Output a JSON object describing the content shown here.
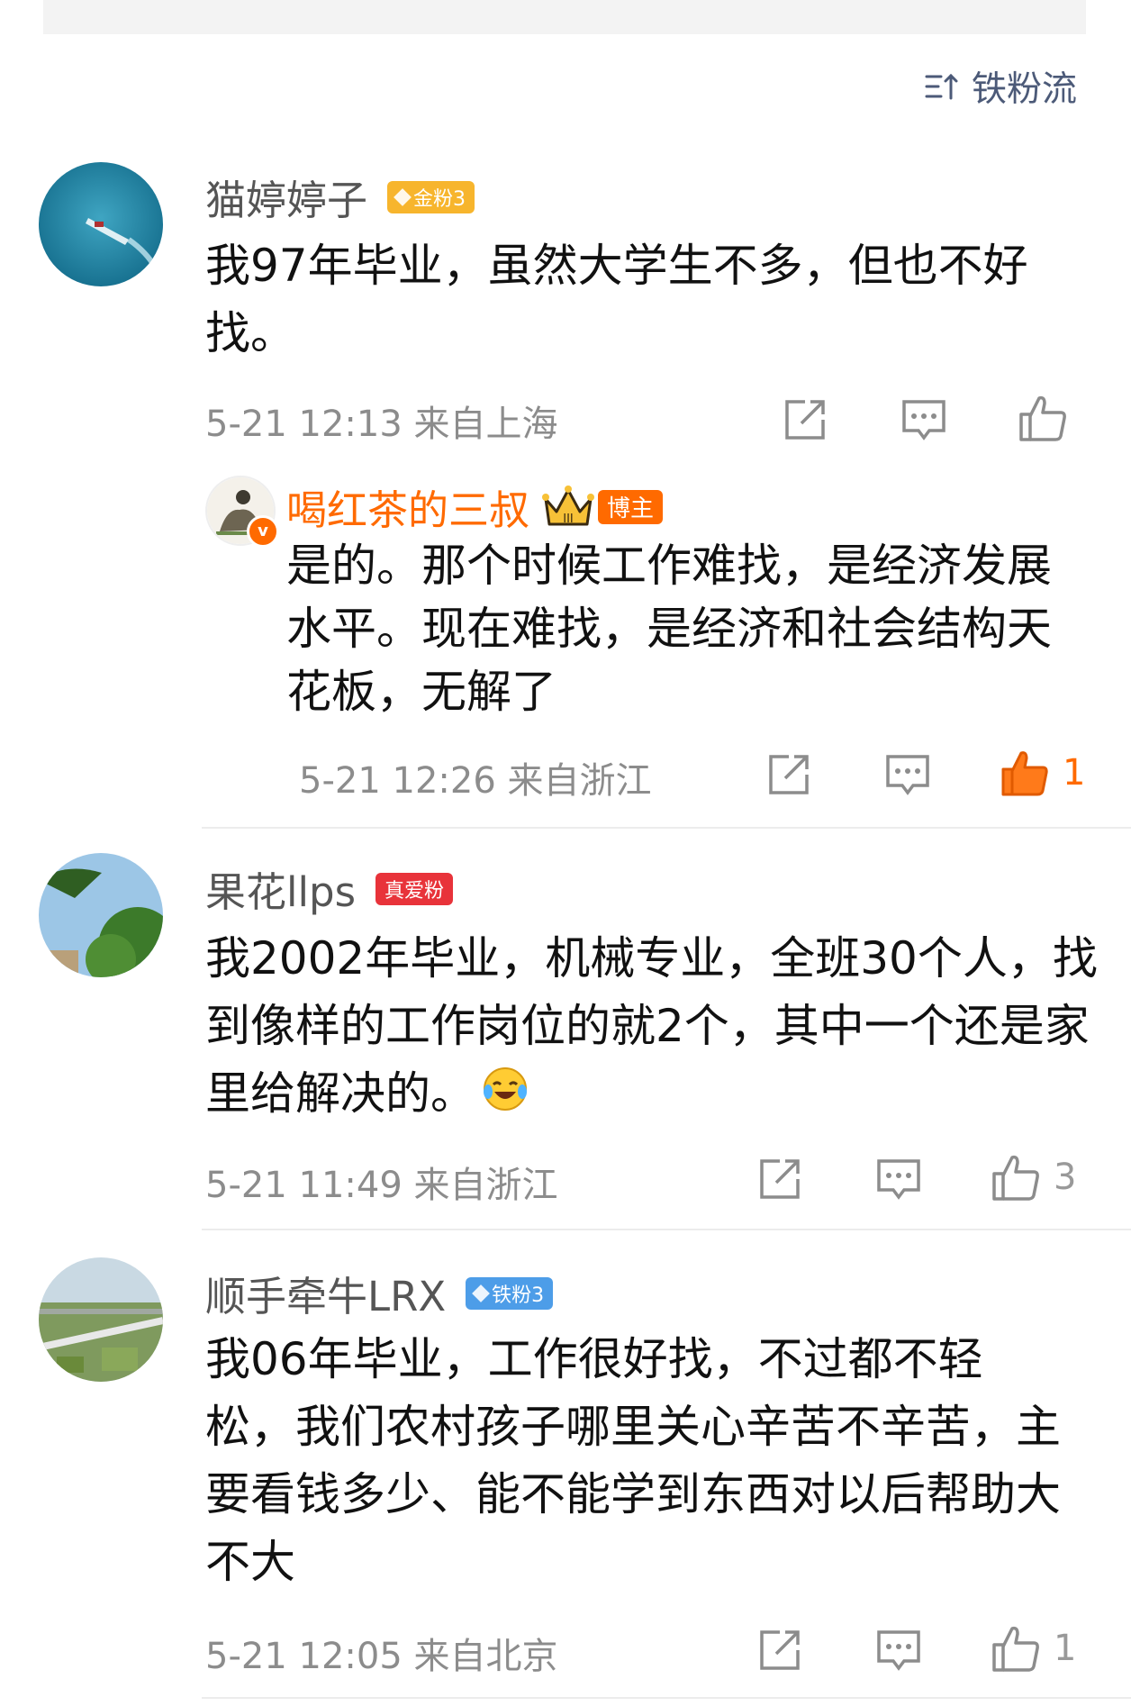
{
  "sort": {
    "label": "铁粉流"
  },
  "comments": [
    {
      "username": "猫婷婷子",
      "badge": "金粉3",
      "text": "我97年毕业，虽然大学生不多，但也不好找。",
      "meta": "5-21 12:13 来自上海",
      "likes": "",
      "reply": {
        "username": "喝红茶的三叔",
        "badge": "博主",
        "text": "是的。那个时候工作难找，是经济发展水平。现在难找，是经济和社会结构天花板，无解了",
        "meta": "5-21 12:26 来自浙江",
        "likes": "1"
      }
    },
    {
      "username": "果花llps",
      "badge": "真爱粉",
      "text": "我2002年毕业，机械专业，全班30个人，找到像样的工作岗位的就2个，其中一个还是家里给解决的。",
      "meta": "5-21 11:49 来自浙江",
      "likes": "3"
    },
    {
      "username": "顺手牵牛LRX",
      "badge": "铁粉3",
      "text": "我06年毕业，工作很好找，不过都不轻松，我们农村孩子哪里关心辛苦不辛苦，主要看钱多少、能不能学到东西对以后帮助大不大",
      "meta": "5-21 12:05 来自北京",
      "likes": "1"
    }
  ],
  "colors": {
    "accent": "#ff6a00",
    "badge_gold": "#f7b52d",
    "badge_red": "#e8333a",
    "badge_blue": "#4d9de8"
  },
  "icons": [
    "sort-icon",
    "share-icon",
    "comment-icon",
    "like-icon",
    "laugh-cry-emoji",
    "crown-icon",
    "verified-icon"
  ]
}
